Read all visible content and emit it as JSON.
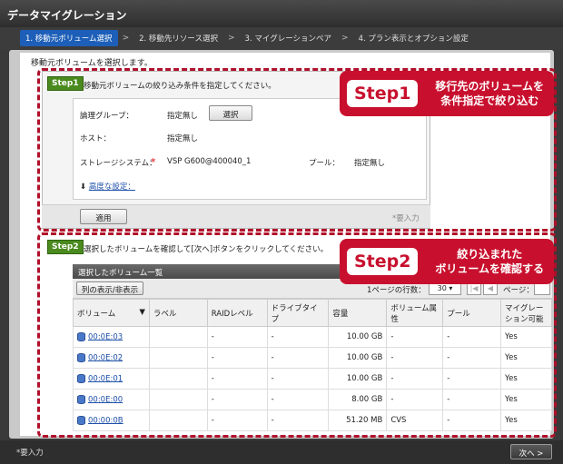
{
  "window": {
    "title": "データマイグレーション"
  },
  "wizard": {
    "steps": [
      "1. 移動元ボリューム選択",
      "2. 移動先リソース選択",
      "3. マイグレーションペア",
      "4. プラン表示とオプション設定"
    ],
    "separator": ">"
  },
  "intro": "移動元ボリュームを選択します。",
  "step1": {
    "badge": "Step1",
    "instruction": "移動元ボリュームの絞り込み条件を指定してください。",
    "logical_group_label": "論理グループ：",
    "logical_group_value": "指定無し",
    "select_button": "選択",
    "host_label": "ホスト：",
    "host_value": "指定無し",
    "storage_label": "ストレージシステム：",
    "storage_required": "*",
    "storage_value": "VSP G600@400040_1",
    "pool_label": "プール：",
    "pool_value": "指定無し",
    "advanced_link": "高度な設定：",
    "apply_button": "適用",
    "required_note": "*要入力"
  },
  "callout1": {
    "title": "Step1",
    "desc_line1": "移行先のボリュームを",
    "desc_line2": "条件指定で絞り込む"
  },
  "step2": {
    "badge": "Step2",
    "instruction": "選択したボリュームを確認して[次へ]ボタンをクリックしてください。"
  },
  "callout2": {
    "title": "Step2",
    "desc_line1": "絞り込まれた",
    "desc_line2": "ボリュームを確認する"
  },
  "table": {
    "title": "選択したボリューム一覧",
    "column_toggle": "列の表示/非表示",
    "rows_per_page_label": "1ページの行数：",
    "rows_per_page": "30",
    "page_label": "ページ：",
    "headers": [
      "ボリューム",
      "ラベル",
      "RAIDレベル",
      "ドライブタイプ",
      "容量",
      "ボリューム属性",
      "プール",
      "マイグレーション可能"
    ],
    "rows": [
      {
        "volume": "00:0E:03",
        "label": "",
        "raid": "-",
        "drive": "-",
        "capacity": "10.00 GB",
        "attr": "-",
        "pool": "-",
        "migratable": "Yes"
      },
      {
        "volume": "00:0E:02",
        "label": "",
        "raid": "-",
        "drive": "-",
        "capacity": "10.00 GB",
        "attr": "-",
        "pool": "-",
        "migratable": "Yes"
      },
      {
        "volume": "00:0E:01",
        "label": "",
        "raid": "-",
        "drive": "-",
        "capacity": "10.00 GB",
        "attr": "-",
        "pool": "-",
        "migratable": "Yes"
      },
      {
        "volume": "00:0E:00",
        "label": "",
        "raid": "-",
        "drive": "-",
        "capacity": "8.00 GB",
        "attr": "-",
        "pool": "-",
        "migratable": "Yes"
      },
      {
        "volume": "00:00:0B",
        "label": "",
        "raid": "-",
        "drive": "-",
        "capacity": "51.20 MB",
        "attr": "CVS",
        "pool": "-",
        "migratable": "Yes"
      }
    ]
  },
  "footer": {
    "required_note": "*要入力",
    "next_button": "次へ >"
  },
  "icons": {
    "volume": "database-icon",
    "sort": "sort-down-icon",
    "dropdown": "chevron-down-icon"
  }
}
